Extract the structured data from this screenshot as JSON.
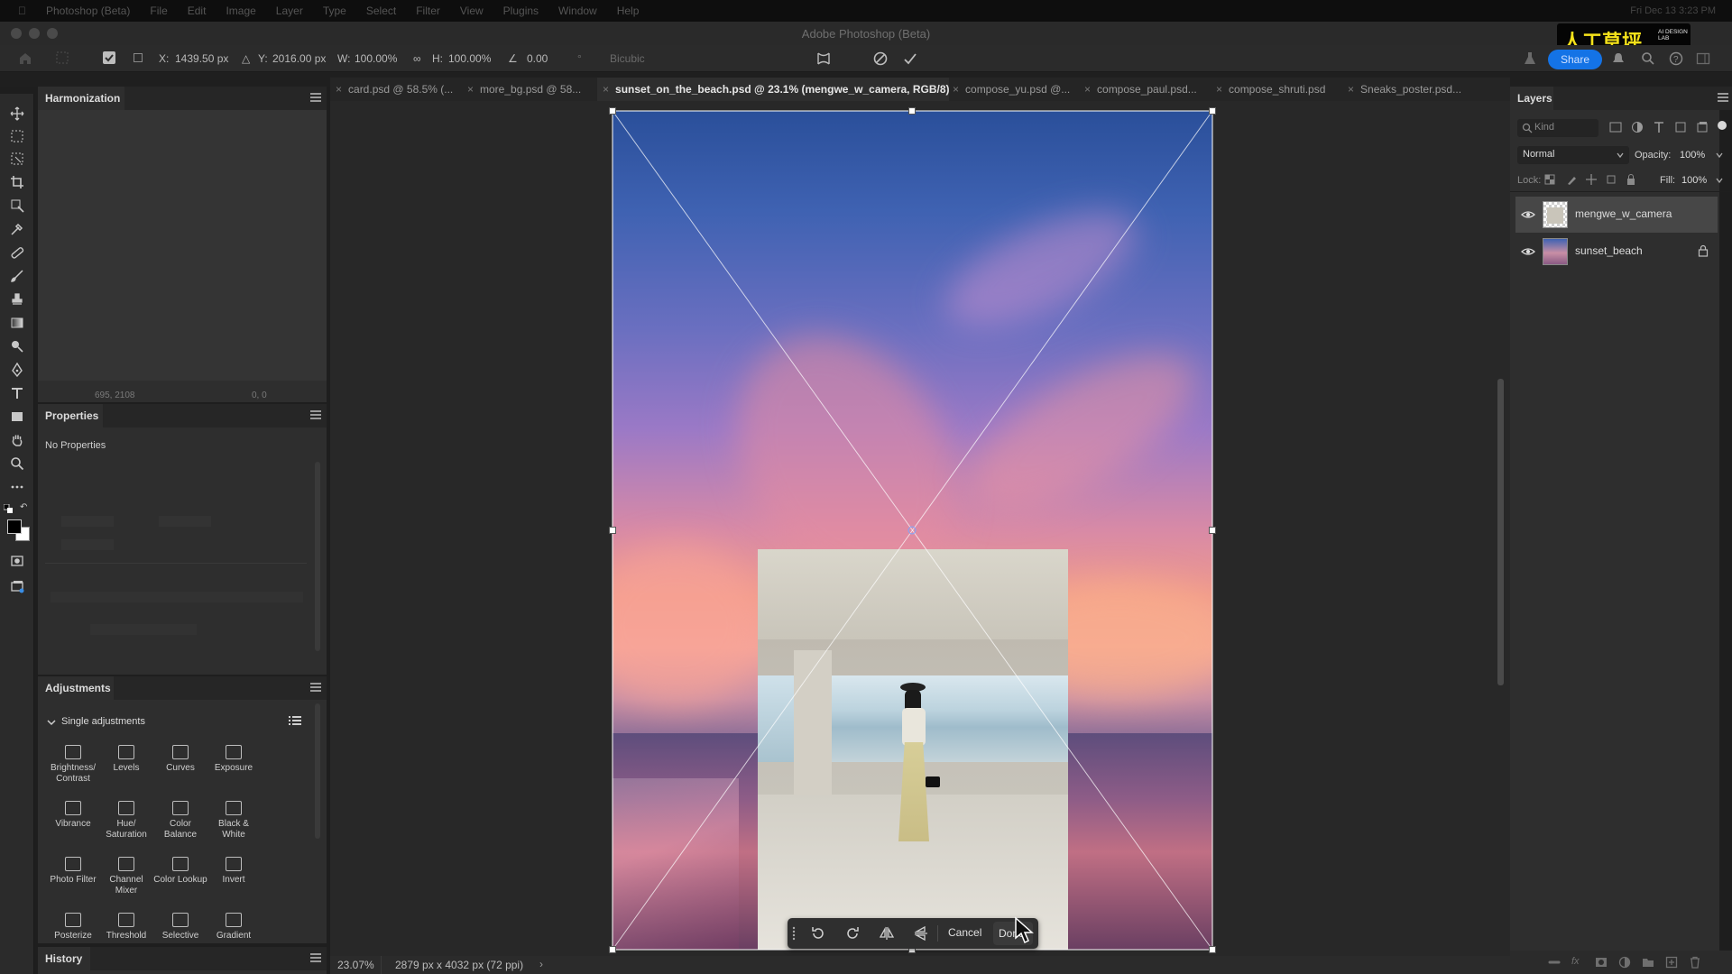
{
  "app": {
    "window_title": "Adobe Photoshop (Beta)",
    "menu": [
      "Photoshop (Beta)",
      "File",
      "Edit",
      "Image",
      "Layer",
      "Type",
      "Select",
      "Filter",
      "View",
      "Plugins",
      "Window",
      "Help"
    ],
    "menu_right_text": "Fri Dec 13 3:23 PM"
  },
  "options_bar": {
    "x_label": "X:",
    "x_value": "1439.50 px",
    "y_label": "Y:",
    "y_value": "2016.00 px",
    "w_label": "W:",
    "w_value": "100.00%",
    "h_label": "H:",
    "h_value": "100.00%",
    "angle_value": "0.00",
    "interp_label": "Bicubic",
    "share_label": "Share"
  },
  "watermark": {
    "text": "人工草坪",
    "sub": "AI DESIGN LAB"
  },
  "tabs": [
    {
      "label": "card.psd @ 58.5% (...",
      "active": false
    },
    {
      "label": "more_bg.psd @ 58...",
      "active": false
    },
    {
      "label": "sunset_on_the_beach.psd @ 23.1% (mengwe_w_camera, RGB/8)",
      "active": true
    },
    {
      "label": "compose_yu.psd @...",
      "active": false
    },
    {
      "label": "compose_paul.psd...",
      "active": false
    },
    {
      "label": "compose_shruti.psd",
      "active": false
    },
    {
      "label": "Sneaks_poster.psd...",
      "active": false
    }
  ],
  "harmonization": {
    "title": "Harmonization",
    "footer_left": "695, 2108",
    "footer_right": "0, 0"
  },
  "properties": {
    "title": "Properties",
    "empty_text": "No Properties"
  },
  "adjustments": {
    "title": "Adjustments",
    "section": "Single adjustments",
    "items": [
      {
        "label": "Brightness/ Contrast",
        "icon": "brightness-icon"
      },
      {
        "label": "Levels",
        "icon": "levels-icon"
      },
      {
        "label": "Curves",
        "icon": "curves-icon"
      },
      {
        "label": "Exposure",
        "icon": "exposure-icon"
      },
      {
        "label": "Vibrance",
        "icon": "vibrance-icon"
      },
      {
        "label": "Hue/ Saturation",
        "icon": "hue-saturation-icon"
      },
      {
        "label": "Color Balance",
        "icon": "color-balance-icon"
      },
      {
        "label": "Black & White",
        "icon": "black-white-icon"
      },
      {
        "label": "Photo Filter",
        "icon": "photo-filter-icon"
      },
      {
        "label": "Channel Mixer",
        "icon": "channel-mixer-icon"
      },
      {
        "label": "Color Lookup",
        "icon": "color-lookup-icon"
      },
      {
        "label": "Invert",
        "icon": "invert-icon"
      },
      {
        "label": "Posterize",
        "icon": "posterize-icon"
      },
      {
        "label": "Threshold",
        "icon": "threshold-icon"
      },
      {
        "label": "Selective",
        "icon": "selective-color-icon"
      },
      {
        "label": "Gradient",
        "icon": "gradient-map-icon"
      }
    ]
  },
  "history": {
    "title": "History"
  },
  "layers": {
    "title": "Layers",
    "filter_placeholder": "Kind",
    "blend_mode": "Normal",
    "opacity_label": "Opacity:",
    "opacity_value": "100%",
    "lock_label": "Lock:",
    "fill_label": "Fill:",
    "fill_value": "100%",
    "items": [
      {
        "name": "mengwe_w_camera",
        "selected": true,
        "locked": false
      },
      {
        "name": "sunset_beach",
        "selected": false,
        "locked": true
      }
    ]
  },
  "transform_bar": {
    "cancel_label": "Cancel",
    "done_label": "Done"
  },
  "status": {
    "zoom": "23.07%",
    "doc_info": "2879 px x 4032 px (72 ppi)"
  }
}
